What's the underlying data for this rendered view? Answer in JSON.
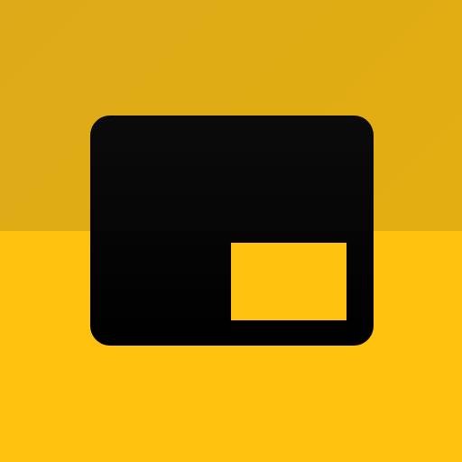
{
  "app_icon": {
    "name": "picture-in-picture-icon",
    "colors": {
      "background_top": "#DEAA19",
      "background_bottom": "#FFC20E",
      "glyph": "#000000",
      "inset_window": "#FFC20E"
    }
  }
}
